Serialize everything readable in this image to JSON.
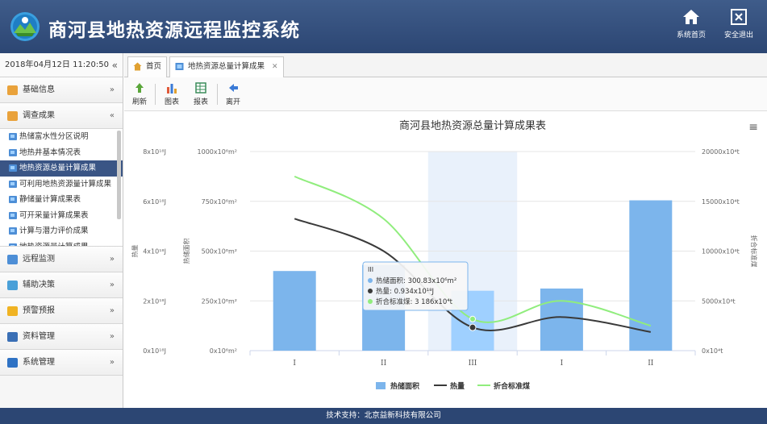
{
  "header": {
    "title": "商河县地热资源远程监控系统",
    "home_label": "系统首页",
    "logout_label": "安全退出"
  },
  "sidebar": {
    "datetime": "2018年04月12日 11:20:50",
    "collapse_glyph": "«",
    "sections": [
      {
        "label": "基础信息",
        "chevron": "»",
        "color": "#e9a23b"
      },
      {
        "label": "调查成果",
        "chevron": "«",
        "color": "#e9a23b"
      },
      {
        "label": "远程监测",
        "chevron": "»",
        "color": "#4d8ed6"
      },
      {
        "label": "辅助决策",
        "chevron": "»",
        "color": "#4aa0d8"
      },
      {
        "label": "预警预报",
        "chevron": "»",
        "color": "#f0b323"
      },
      {
        "label": "资料管理",
        "chevron": "»",
        "color": "#3a6fb5"
      },
      {
        "label": "系统管理",
        "chevron": "»",
        "color": "#2f72c4"
      }
    ],
    "sub_items": [
      "热储富水性分区说明",
      "地热井基本情况表",
      "地热资源总量计算成果",
      "可利用地热资源量计算成果",
      "静储量计算成果表",
      "可开采量计算成果表",
      "计算与潜力评价成果",
      "地热资源量计算成果",
      "地热水分析成果表",
      "地热水质量评价成果"
    ],
    "active_sub_index": 2
  },
  "tabs": {
    "home_label": "首页",
    "report_label": "地热资源总量计算成果",
    "close_glyph": "✕"
  },
  "toolbar": {
    "refresh_label": "刷新",
    "chart_label": "图表",
    "table_label": "报表",
    "exit_label": "离开"
  },
  "footer": {
    "text": "技术支持：北京益新科技有限公司"
  },
  "colors": {
    "bar": "#7cb5ec",
    "bar_highlight": "#9fd0ff",
    "heat_line": "#3a3a3a",
    "coal_line": "#90ed7d",
    "band": "#e9f1fb"
  },
  "chart_data": {
    "type": "bar",
    "title": "商河县地热资源总量计算成果表",
    "menu_glyph": "≡",
    "categories": [
      "I",
      "II",
      "III",
      "I",
      "II"
    ],
    "highlight_index": 2,
    "series": [
      {
        "name": "热储面积",
        "kind": "bar",
        "axis": "area",
        "values": [
          400,
          430,
          300.83,
          312,
          755
        ]
      },
      {
        "name": "热量",
        "kind": "line",
        "axis": "heat",
        "values": [
          5.3,
          4.0,
          0.934,
          1.35,
          0.75
        ]
      },
      {
        "name": "折合标准煤",
        "kind": "line",
        "axis": "heat",
        "values": [
          7.0,
          5.3,
          1.27,
          2.0,
          1.0
        ]
      }
    ],
    "axes": {
      "heat": {
        "label": "热量",
        "ticks": [
          "0x10¹⁸J",
          "2x10¹⁸J",
          "4x10¹⁸J",
          "6x10¹⁸J",
          "8x10¹⁸J"
        ],
        "range": [
          0,
          8
        ]
      },
      "area": {
        "label": "热储面积",
        "ticks": [
          "0x10⁶m²",
          "250x10⁶m²",
          "500x10⁶m²",
          "750x10⁶m²",
          "1000x10⁶m²"
        ],
        "range": [
          0,
          1000
        ]
      },
      "coal": {
        "label": "折合标准煤",
        "ticks": [
          "0x10⁴t",
          "5000x10⁴t",
          "10000x10⁴t",
          "15000x10⁴t",
          "20000x10⁴t"
        ],
        "range": [
          0,
          20000
        ]
      }
    },
    "tooltip": {
      "title": "III",
      "lines": [
        "热储面积: 300.83x10⁶m²",
        "热量: 0.934x10¹⁸J",
        "折合标准煤: 3 186x10⁴t"
      ]
    },
    "legend_position": "bottom"
  }
}
